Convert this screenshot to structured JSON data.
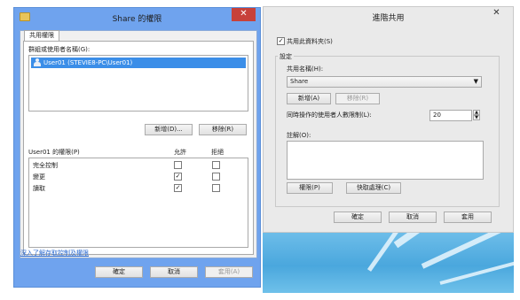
{
  "share_perm_window": {
    "title": "Share 的權限",
    "close_glyph": "✕",
    "tab_label": "共用權限",
    "group_label": "群組或使用者名稱(G):",
    "users": [
      "User01 (STEVIE8-PC\\User01)"
    ],
    "add_button": "新增(D)...",
    "remove_button": "移除(R)",
    "perm_title": "User01 的權限(P)",
    "col_allow": "允許",
    "col_deny": "拒絕",
    "permissions": [
      {
        "name": "完全控制",
        "allow": false,
        "deny": false
      },
      {
        "name": "變更",
        "allow": true,
        "deny": false
      },
      {
        "name": "讀取",
        "allow": true,
        "deny": false
      }
    ],
    "check_mark": "✓",
    "help_link": "深入了解存取控制及權限",
    "ok_button": "確定",
    "cancel_button": "取消",
    "apply_button": "套用(A)"
  },
  "advanced_share_window": {
    "title": "進階共用",
    "close_glyph": "✕",
    "share_checkbox_label": "共用此資料夾(S)",
    "share_checked": true,
    "settings_label": "設定",
    "share_name_label": "共用名稱(H):",
    "share_name_value": "Share",
    "combo_arrow": "▼",
    "add_button": "新增(A)",
    "remove_button": "移除(R)",
    "limit_label": "同時操作的使用者人數限制(L):",
    "limit_value": "20",
    "spin_up": "▲",
    "spin_down": "▼",
    "comment_label": "註解(O):",
    "permissions_button": "權限(P)",
    "caching_button": "快取處理(C)",
    "ok_button": "確定",
    "cancel_button": "取消",
    "apply_button": "套用"
  },
  "colors": {
    "title_bar_active": "#6fa3ee",
    "close_button": "#c7413a",
    "selection": "#3b8ee8",
    "link": "#2a6ad0"
  }
}
